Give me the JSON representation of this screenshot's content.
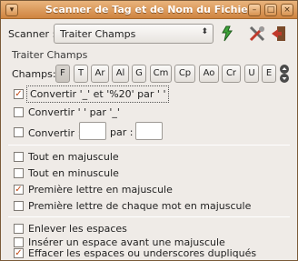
{
  "window": {
    "title": "Scanner de Tag et de Nom du Fichier"
  },
  "scanner": {
    "label": "Scanner :",
    "value": "Traiter Champs"
  },
  "frame": {
    "title": "Traiter Champs"
  },
  "champs": {
    "label": "Champs:",
    "tags": [
      "F",
      "T",
      "Ar",
      "Al",
      "G",
      "Cm",
      "Cp",
      "Ao",
      "Cr",
      "U",
      "E"
    ],
    "active_index": 0
  },
  "options": {
    "convert_underscore": {
      "label": "Convertir '_' et '%20' par ' '",
      "checked": true
    },
    "convert_space": {
      "label": "Convertir ' ' par '_'",
      "checked": false
    },
    "convert_custom": {
      "label": "Convertir :",
      "par_label": "par :",
      "from_value": "",
      "to_value": "",
      "checked": false
    },
    "all_upper": {
      "label": "Tout en majuscule",
      "checked": false
    },
    "all_lower": {
      "label": "Tout en minuscule",
      "checked": false
    },
    "first_upper": {
      "label": "Première lettre en majuscule",
      "checked": true
    },
    "first_each_upper": {
      "label": "Première lettre de chaque mot en majuscule",
      "checked": false
    },
    "remove_spaces": {
      "label": "Enlever les espaces",
      "checked": false
    },
    "insert_space": {
      "label": "Insérer un espace avant une majuscule",
      "checked": false
    },
    "remove_dup": {
      "label": "Effacer les espaces ou underscores dupliqués",
      "checked": true
    }
  },
  "colors": {
    "titlebar": "#d99a5c",
    "accent": "#c24a16"
  }
}
